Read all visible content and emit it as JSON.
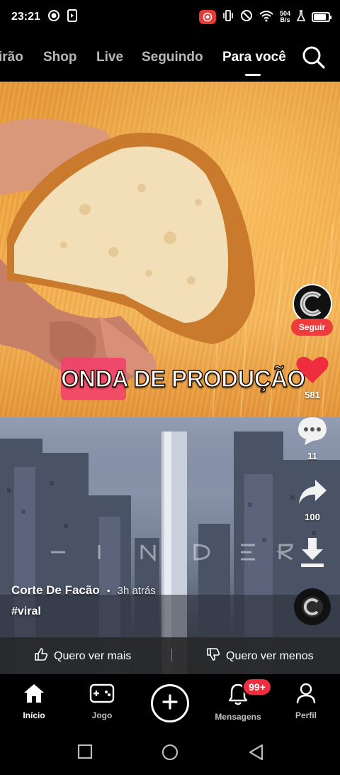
{
  "status_bar": {
    "time": "23:21",
    "net_speed_value": "504",
    "net_speed_unit": "B/s",
    "battery_level": 0.85
  },
  "top_tabs": [
    {
      "label": "irão",
      "active": false
    },
    {
      "label": "Shop",
      "active": false
    },
    {
      "label": "Live",
      "active": false
    },
    {
      "label": "Seguindo",
      "active": false
    },
    {
      "label": "Para você",
      "active": true
    }
  ],
  "video": {
    "caption": "ONDA DE PRODUÇÃO",
    "watermark": "C I N D E R",
    "author": "Corte De Facão",
    "separator": "•",
    "posted": "3h atrás",
    "hashtag": "#viral"
  },
  "actions": {
    "follow": "Seguir",
    "likes": "581",
    "comments": "11",
    "shares": "100"
  },
  "feedback": {
    "more": "Quero ver mais",
    "less": "Quero ver menos"
  },
  "bottom_nav": {
    "home": "Início",
    "game": "Jogo",
    "messages": "Mensagens",
    "messages_badge": "99+",
    "profile": "Perfil"
  },
  "colors": {
    "like": "#ee2d3f",
    "follow": "#ee3b3b",
    "badge": "#ee2d3f",
    "recording": "#e53935"
  }
}
